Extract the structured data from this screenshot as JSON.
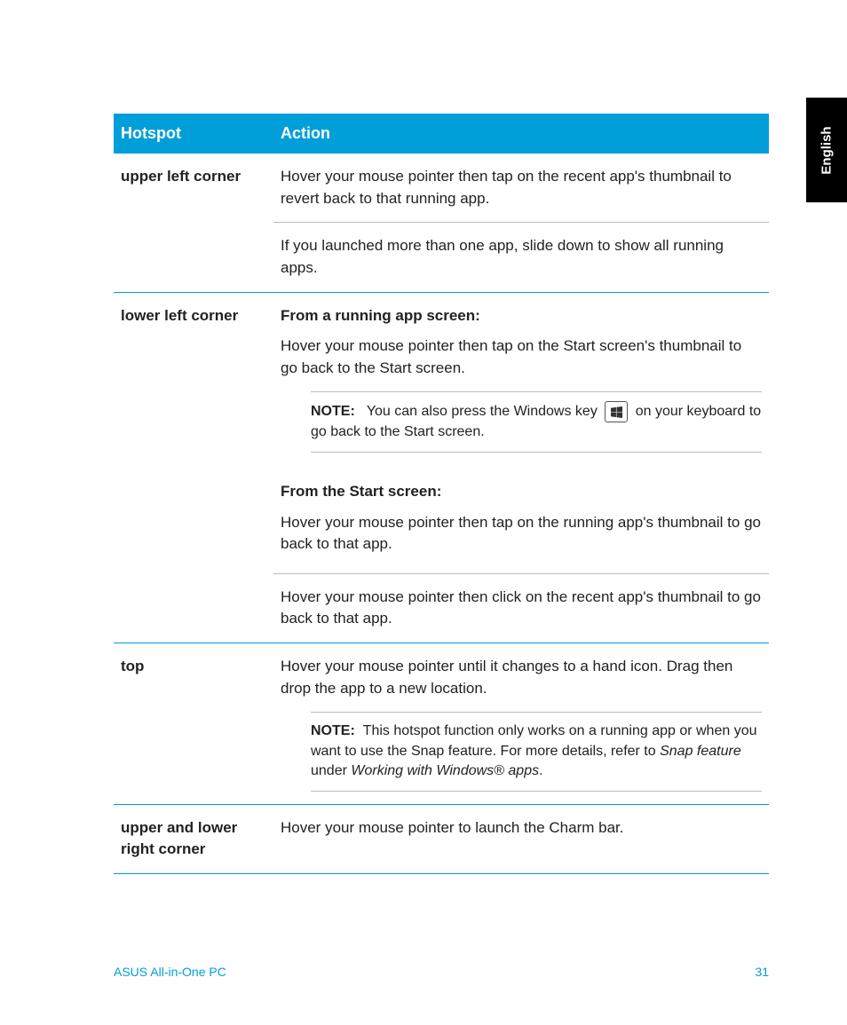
{
  "language_tab": "English",
  "table": {
    "headers": {
      "hotspot": "Hotspot",
      "action": "Action"
    },
    "rows": {
      "upper_left": {
        "name": "upper left corner",
        "action1": "Hover your mouse pointer then tap on the recent app's thumbnail to revert back to that running app.",
        "action2": "If you launched more than one app, slide down to show all running apps."
      },
      "lower_left": {
        "name": "lower left corner",
        "sub1_head": "From a running app screen:",
        "sub1_text": "Hover your mouse pointer then tap on the Start screen's thumbnail to go back to the Start screen.",
        "note1_label": "NOTE:",
        "note1_before": "You can also press the Windows key",
        "note1_after": "on your keyboard to go back to the Start screen.",
        "sub2_head": "From the Start screen:",
        "sub2_text1": "Hover your mouse pointer then tap on the running app's thumbnail to go back to that app.",
        "sub2_text2": "Hover your mouse pointer then click on the recent app's thumbnail to go back to that app."
      },
      "top": {
        "name": "top",
        "action": "Hover your mouse pointer until it changes to a hand icon. Drag then drop the app to a new location.",
        "note_label": "NOTE:",
        "note_text1": "This hotspot function only works on a running app or when you want to use the Snap feature. For more details, refer to ",
        "note_italic1": "Snap feature",
        "note_text2": " under ",
        "note_italic2": "Working with Windows® apps",
        "note_text3": "."
      },
      "right": {
        "name": "upper and lower right corner",
        "action": "Hover your mouse pointer to launch the Charm bar."
      }
    }
  },
  "footer": {
    "product": "ASUS All-in-One PC",
    "page": "31"
  }
}
